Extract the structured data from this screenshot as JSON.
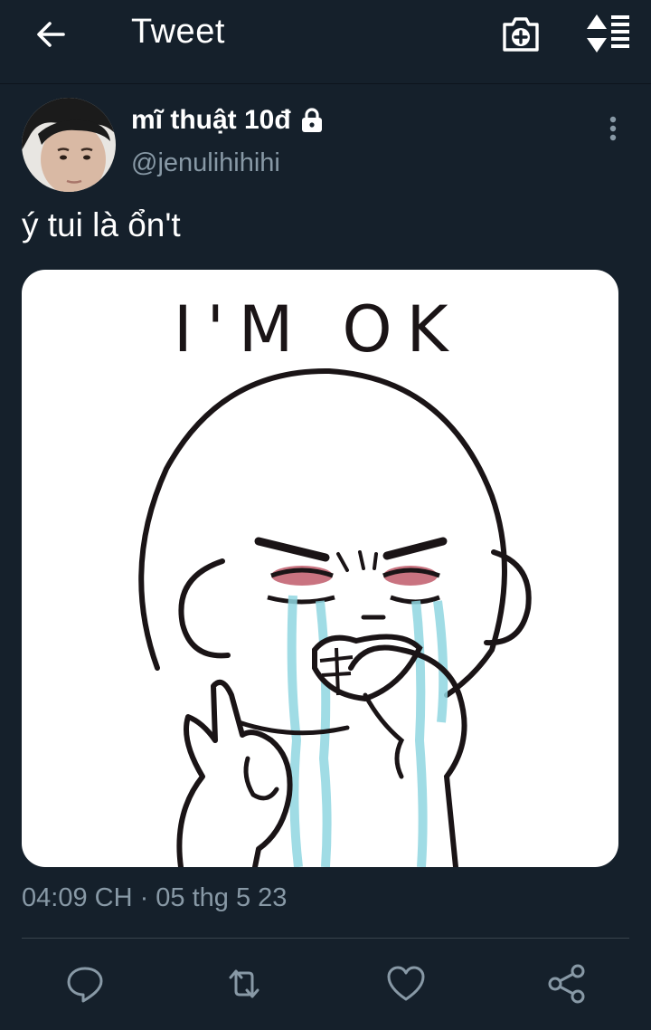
{
  "header": {
    "title": "Tweet",
    "back_icon": "arrow-left-icon",
    "camera_icon": "camera-add-icon",
    "sort_icon": "sort-toggle-icon"
  },
  "tweet": {
    "display_name": "mĩ thuật 10đ",
    "handle": "@jenulihihihi",
    "protected_icon": "lock-icon",
    "text": "ý tui là ổn't",
    "media_caption": "I'M OK",
    "timestamp": "04:09 CH · 05 thg 5 23"
  },
  "actions": [
    "reply-icon",
    "retweet-icon",
    "like-icon",
    "share-icon"
  ],
  "colors": {
    "background": "#15202b",
    "secondary_text": "#8899a6",
    "divider": "#38444d"
  }
}
